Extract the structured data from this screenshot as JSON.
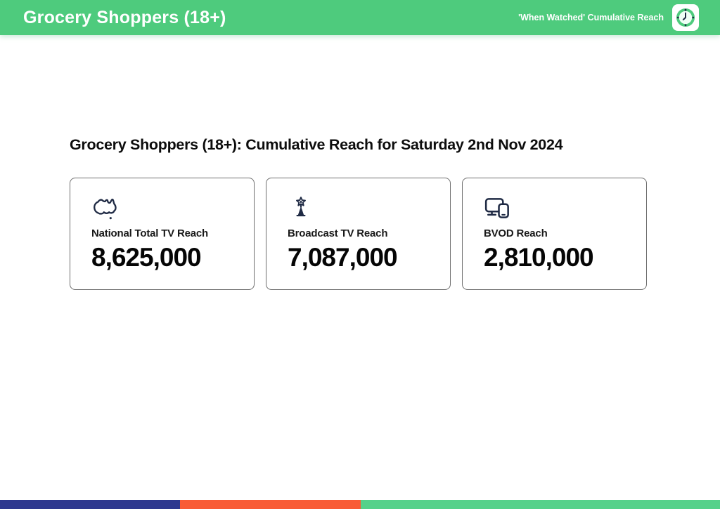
{
  "header": {
    "title": "Grocery Shoppers (18+)",
    "tagline": "'When Watched' Cumulative Reach",
    "bg_color": "#4ecb7d",
    "clock_icon": "clock-in-white-rounded-square"
  },
  "main": {
    "heading": "Grocery Shoppers (18+): Cumulative Reach for Saturday 2nd Nov 2024",
    "cards": [
      {
        "icon": "australia-map",
        "label": "National Total TV Reach",
        "value": "8,625,000"
      },
      {
        "icon": "broadcast-tower",
        "label": "Broadcast TV Reach",
        "value": "7,087,000"
      },
      {
        "icon": "tv-and-phone-devices",
        "label": "BVOD Reach",
        "value": "2,810,000"
      }
    ],
    "icon_color": "#1f2a44"
  },
  "footer": {
    "segments": [
      {
        "name": "navy",
        "color": "#2e388f"
      },
      {
        "name": "orange",
        "color": "#f95b35"
      },
      {
        "name": "green",
        "color": "#55d18a"
      }
    ]
  }
}
